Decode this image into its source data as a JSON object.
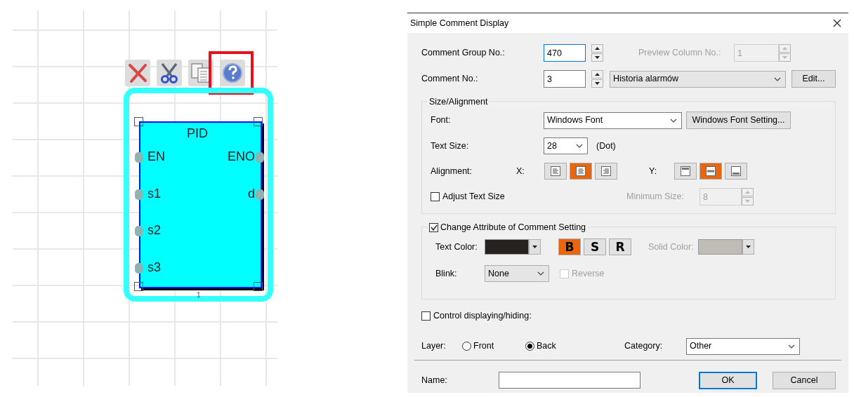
{
  "canvas": {
    "toolbar": [
      {
        "kind": "delete",
        "highlighted": false
      },
      {
        "kind": "cut",
        "highlighted": false
      },
      {
        "kind": "copy",
        "highlighted": false
      },
      {
        "kind": "help",
        "highlighted": true
      }
    ],
    "block": {
      "title": "PID",
      "selected": true,
      "inputs": [
        "EN",
        "s1",
        "s2",
        "s3"
      ],
      "outputs": [
        "ENO",
        "d"
      ],
      "footer": "1"
    }
  },
  "dialog": {
    "title": "Simple Comment Display",
    "comment_group": {
      "label": "Comment Group No.:",
      "value": "470"
    },
    "preview_column": {
      "label": "Preview Column No.:",
      "value": "1",
      "disabled": true
    },
    "comment_no": {
      "label": "Comment No.:",
      "value": "3",
      "comment": "Historia alarmów",
      "edit_button": "Edit..."
    },
    "size_alignment": {
      "title": "Size/Alignment",
      "font_label": "Font:",
      "font": "Windows Font",
      "font_button": "Windows Font Setting...",
      "text_size_label": "Text Size:",
      "text_size": "28",
      "unit": "(Dot)",
      "alignment_label": "Alignment:",
      "x_label": "X:",
      "y_label": "Y:",
      "x_options": [
        {
          "kind": "left",
          "selected": false
        },
        {
          "kind": "center",
          "selected": true
        },
        {
          "kind": "right",
          "selected": false
        }
      ],
      "y_options": [
        {
          "kind": "top",
          "selected": false
        },
        {
          "kind": "middle",
          "selected": true
        },
        {
          "kind": "bottom",
          "selected": false
        }
      ],
      "adjust": {
        "label": "Adjust Text Size",
        "checked": false
      },
      "minimum": {
        "label": "Minimum Size:",
        "value": "8",
        "disabled": true
      }
    },
    "attribute": {
      "label": "Change Attribute of Comment Setting",
      "checked": true,
      "text_color_label": "Text Color:",
      "styles": [
        {
          "label": "B",
          "selected": true
        },
        {
          "label": "S",
          "selected": false
        },
        {
          "label": "R",
          "selected": false
        }
      ],
      "solid_color_label": "Solid Color:",
      "solid_disabled": true,
      "blink_label": "Blink:",
      "blink": "None",
      "reverse": {
        "label": "Reverse",
        "checked": false,
        "disabled": true
      }
    },
    "control": {
      "label": "Control displaying/hiding:",
      "checked": false
    },
    "layer_label": "Layer:",
    "layers": [
      {
        "label": "Front",
        "selected": false
      },
      {
        "label": "Back",
        "selected": true
      }
    ],
    "category_label": "Category:",
    "category": "Other",
    "name_label": "Name:",
    "buttons": [
      {
        "label": "OK",
        "default": true
      },
      {
        "label": "Cancel",
        "default": false
      }
    ]
  }
}
